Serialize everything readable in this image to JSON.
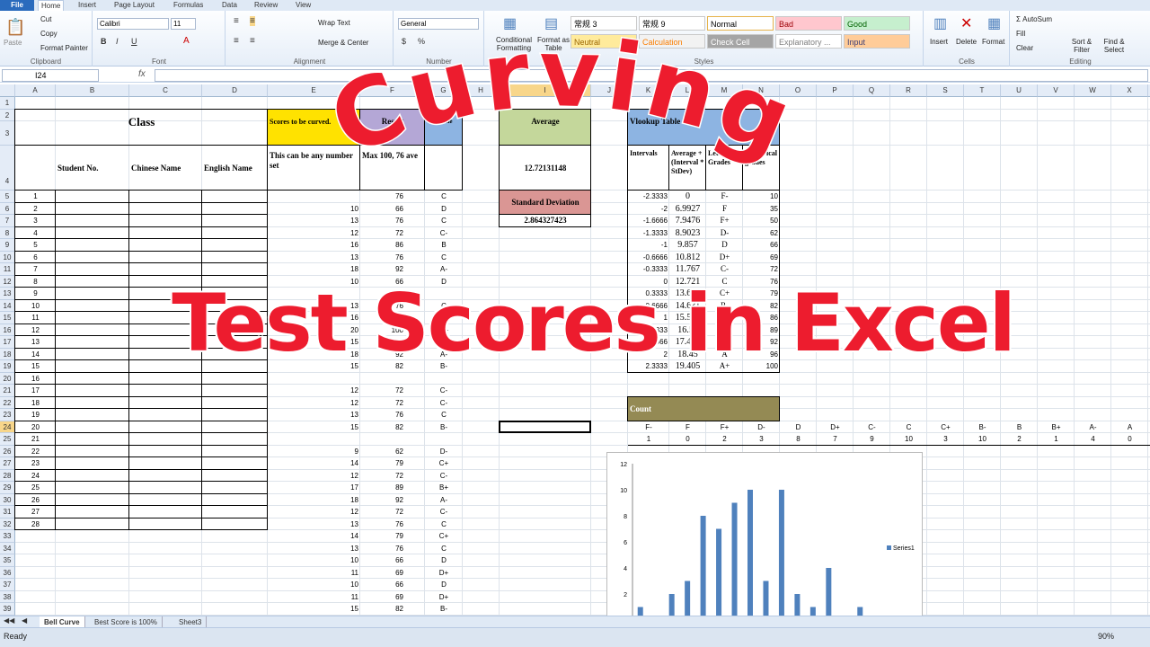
{
  "ribbon": {
    "tabs": [
      "File",
      "Home",
      "Insert",
      "Page Layout",
      "Formulas",
      "Data",
      "Review",
      "View"
    ],
    "clipboard": {
      "label": "Clipboard",
      "paste": "Paste",
      "cut": "Cut",
      "copy": "Copy",
      "format_painter": "Format Painter"
    },
    "font": {
      "label": "Font",
      "name": "Calibri",
      "size": "11"
    },
    "alignment": {
      "label": "Alignment",
      "wrap": "Wrap Text",
      "merge": "Merge & Center"
    },
    "number": {
      "label": "Number",
      "format": "General"
    },
    "styles": {
      "label": "Styles",
      "conditional": "Conditional Formatting",
      "format_table": "Format as Table",
      "cells": [
        {
          "text": "常规 3",
          "bg": "#ffffff",
          "fg": "#000000"
        },
        {
          "text": "常规 9",
          "bg": "#ffffff",
          "fg": "#000000"
        },
        {
          "text": "Normal",
          "bg": "#ffffff",
          "fg": "#000000"
        },
        {
          "text": "Bad",
          "bg": "#ffc7ce",
          "fg": "#9c0006"
        },
        {
          "text": "Good",
          "bg": "#c6efce",
          "fg": "#006100"
        },
        {
          "text": "Neutral",
          "bg": "#ffeb9c",
          "fg": "#9c6500"
        },
        {
          "text": "Calculation",
          "bg": "#f2f2f2",
          "fg": "#fa7d00"
        },
        {
          "text": "Check Cell",
          "bg": "#a5a5a5",
          "fg": "#ffffff"
        },
        {
          "text": "Explanatory ...",
          "bg": "#ffffff",
          "fg": "#7f7f7f"
        },
        {
          "text": "Input",
          "bg": "#ffcc99",
          "fg": "#3f3f76"
        }
      ]
    },
    "cells": {
      "label": "Cells",
      "insert": "Insert",
      "delete": "Delete",
      "format": "Format"
    },
    "editing": {
      "label": "Editing",
      "autosum": "AutoSum",
      "fill": "Fill",
      "clear": "Clear",
      "sort": "Sort & Filter",
      "find": "Find & Select"
    }
  },
  "formula_bar": {
    "name_box": "I24",
    "fx": "fx",
    "value": ""
  },
  "columns": [
    "A",
    "B",
    "C",
    "D",
    "E",
    "F",
    "G",
    "H",
    "I",
    "J",
    "K",
    "L",
    "M",
    "N",
    "O",
    "P",
    "Q",
    "R",
    "S",
    "T",
    "U",
    "V",
    "W",
    "X",
    "Y"
  ],
  "rows": [
    "1",
    "2",
    "3",
    "4",
    "5",
    "6",
    "7",
    "8",
    "9",
    "10",
    "11",
    "12",
    "13",
    "14",
    "15",
    "16",
    "17",
    "18",
    "19",
    "20",
    "21",
    "22",
    "23",
    "24",
    "25",
    "26",
    "27",
    "28",
    "29",
    "30",
    "31",
    "32",
    "33",
    "34",
    "35",
    "36",
    "37",
    "38",
    "39",
    "40",
    "41"
  ],
  "selected_cell": "I24",
  "class_table": {
    "title": "Class",
    "headers": [
      "Student No.",
      "Chinese Name",
      "English Name"
    ],
    "numbers": [
      "1",
      "2",
      "3",
      "4",
      "5",
      "6",
      "7",
      "8",
      "9",
      "10",
      "11",
      "12",
      "13",
      "14",
      "15",
      "16",
      "17",
      "18",
      "19",
      "20",
      "21",
      "22",
      "23",
      "24",
      "25",
      "26",
      "27",
      "28"
    ]
  },
  "scores": {
    "header": "Scores to be curved.",
    "subtext": "This can be any number set",
    "result_header": "Result",
    "result_sub": "Max 100, 76 ave",
    "letter_header": "Letter Grade",
    "rows": [
      {
        "e": "",
        "f": "76",
        "g": "C"
      },
      {
        "e": "10",
        "f": "66",
        "g": "D"
      },
      {
        "e": "13",
        "f": "76",
        "g": "C"
      },
      {
        "e": "12",
        "f": "72",
        "g": "C-"
      },
      {
        "e": "16",
        "f": "86",
        "g": "B"
      },
      {
        "e": "13",
        "f": "76",
        "g": "C"
      },
      {
        "e": "18",
        "f": "92",
        "g": "A-"
      },
      {
        "e": "10",
        "f": "66",
        "g": "D"
      },
      {
        "e": "",
        "f": "",
        "g": ""
      },
      {
        "e": "13",
        "f": "76",
        "g": "C"
      },
      {
        "e": "16",
        "f": "86",
        "g": "B"
      },
      {
        "e": "20",
        "f": "100",
        "g": "A+"
      },
      {
        "e": "15",
        "f": "82",
        "g": "B-"
      },
      {
        "e": "18",
        "f": "92",
        "g": "A-"
      },
      {
        "e": "15",
        "f": "82",
        "g": "B-"
      },
      {
        "e": "",
        "f": "",
        "g": ""
      },
      {
        "e": "12",
        "f": "72",
        "g": "C-"
      },
      {
        "e": "12",
        "f": "72",
        "g": "C-"
      },
      {
        "e": "13",
        "f": "76",
        "g": "C"
      },
      {
        "e": "15",
        "f": "82",
        "g": "B-"
      },
      {
        "e": "",
        "f": "",
        "g": ""
      },
      {
        "e": "9",
        "f": "62",
        "g": "D-"
      },
      {
        "e": "14",
        "f": "79",
        "g": "C+"
      },
      {
        "e": "12",
        "f": "72",
        "g": "C-"
      },
      {
        "e": "17",
        "f": "89",
        "g": "B+"
      },
      {
        "e": "18",
        "f": "92",
        "g": "A-"
      },
      {
        "e": "12",
        "f": "72",
        "g": "C-"
      },
      {
        "e": "13",
        "f": "76",
        "g": "C"
      },
      {
        "e": "14",
        "f": "79",
        "g": "C+"
      },
      {
        "e": "13",
        "f": "76",
        "g": "C"
      },
      {
        "e": "10",
        "f": "66",
        "g": "D"
      },
      {
        "e": "11",
        "f": "69",
        "g": "D+"
      },
      {
        "e": "10",
        "f": "66",
        "g": "D"
      },
      {
        "e": "11",
        "f": "69",
        "g": "D+"
      },
      {
        "e": "15",
        "f": "82",
        "g": "B-"
      },
      {
        "e": "12",
        "f": "72",
        "g": "C-"
      },
      {
        "e": "15",
        "f": "82",
        "g": "B-"
      }
    ]
  },
  "stats": {
    "average_label": "Average",
    "average_value": "12.72131148",
    "sd_label": "Standard Deviation",
    "sd_value": "2.864327423"
  },
  "vlookup": {
    "title": "Vlookup Table",
    "headers": [
      "Intervals",
      "Average + (Interval * StDev)",
      "Letter Grades",
      "Numerical grades"
    ],
    "rows": [
      [
        "-2.3333",
        "0",
        "F-",
        "10"
      ],
      [
        "-2",
        "6.9927",
        "F",
        "35"
      ],
      [
        "-1.6666",
        "7.9476",
        "F+",
        "50"
      ],
      [
        "-1.3333",
        "8.9023",
        "D-",
        "62"
      ],
      [
        "-1",
        "9.857",
        "D",
        "66"
      ],
      [
        "-0.6666",
        "10.812",
        "D+",
        "69"
      ],
      [
        "-0.3333",
        "11.767",
        "C-",
        "72"
      ],
      [
        "0",
        "12.721",
        "C",
        "76"
      ],
      [
        "0.3333",
        "13.676",
        "C+",
        "79"
      ],
      [
        "0.6666",
        "14.631",
        "B-",
        "82"
      ],
      [
        "1",
        "15.586",
        "B",
        "86"
      ],
      [
        "1.3333",
        "16.54",
        "B+",
        "89"
      ],
      [
        "1.6666",
        "17.495",
        "A-",
        "92"
      ],
      [
        "2",
        "18.45",
        "A",
        "96"
      ],
      [
        "2.3333",
        "19.405",
        "A+",
        "100"
      ]
    ]
  },
  "count": {
    "label": "Count",
    "grades": [
      "F-",
      "F",
      "F+",
      "D-",
      "D",
      "D+",
      "C-",
      "C",
      "C+",
      "B-",
      "B",
      "B+",
      "A-",
      "A",
      "A+"
    ],
    "values": [
      "1",
      "0",
      "2",
      "3",
      "8",
      "7",
      "9",
      "10",
      "3",
      "10",
      "2",
      "1",
      "4",
      "0",
      "1"
    ]
  },
  "chart_data": {
    "type": "bar",
    "categories": [
      "F-",
      "F",
      "F+",
      "D-",
      "D",
      "D+",
      "C-",
      "C",
      "C+",
      "B-",
      "B",
      "B+",
      "A-",
      "A",
      "A+"
    ],
    "series": [
      {
        "name": "Series1",
        "values": [
          1,
          0,
          2,
          3,
          8,
          7,
          9,
          10,
          3,
          10,
          2,
          1,
          4,
          0,
          1
        ]
      }
    ],
    "ylim": [
      0,
      12
    ],
    "yticks": [
      "0",
      "2",
      "4",
      "6",
      "8",
      "10",
      "12"
    ],
    "legend": "right",
    "color": "#4f81bd"
  },
  "overlay": {
    "line1": "Curving",
    "line2": "Test Scores in Excel",
    "color": "#ed1c2e"
  },
  "sheet_tabs": [
    "Bell Curve",
    "Best Score is 100%",
    "Sheet3"
  ],
  "status": {
    "text": "Ready",
    "zoom": "90%"
  }
}
